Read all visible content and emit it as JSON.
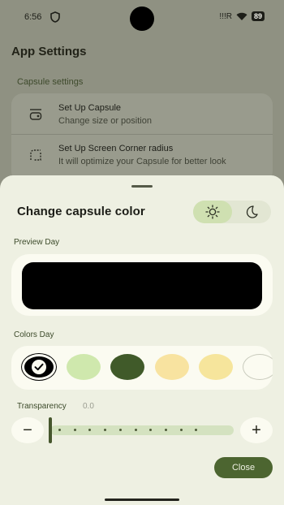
{
  "status_bar": {
    "time": "6:56",
    "signal_text": "!!!R",
    "battery": "89",
    "icons": [
      "shield-icon",
      "signal-icon",
      "wifi-icon",
      "battery-icon"
    ]
  },
  "app": {
    "title": "App Settings",
    "section_label": "Capsule settings",
    "items": [
      {
        "title": "Set Up Capsule",
        "subtitle": "Change size or position",
        "icon": "capsule-icon"
      },
      {
        "title": "Set Up Screen Corner radius",
        "subtitle": "It will optimize your Capsule for better look",
        "icon": "corner-radius-icon"
      }
    ]
  },
  "sheet": {
    "title": "Change capsule color",
    "mode_toggle": {
      "options": [
        "day",
        "night"
      ],
      "selected": "day"
    },
    "preview_label": "Preview Day",
    "preview_color": "#000000",
    "colors_label": "Colors Day",
    "swatches": [
      "#000000",
      "#cfe8ad",
      "#405a29",
      "#f8e3a0",
      "#f6e59c",
      "#fbfbf1"
    ],
    "selected_swatch": 0,
    "transparency_label": "Transparency",
    "transparency_value": "0.0",
    "transparency_fraction": 0.0,
    "minus_symbol": "−",
    "plus_symbol": "+",
    "close_label": "Close"
  },
  "colors": {
    "accent": "#4c6530",
    "sheet_bg": "#eef0e2",
    "toggle_active": "#cfe0b1"
  }
}
